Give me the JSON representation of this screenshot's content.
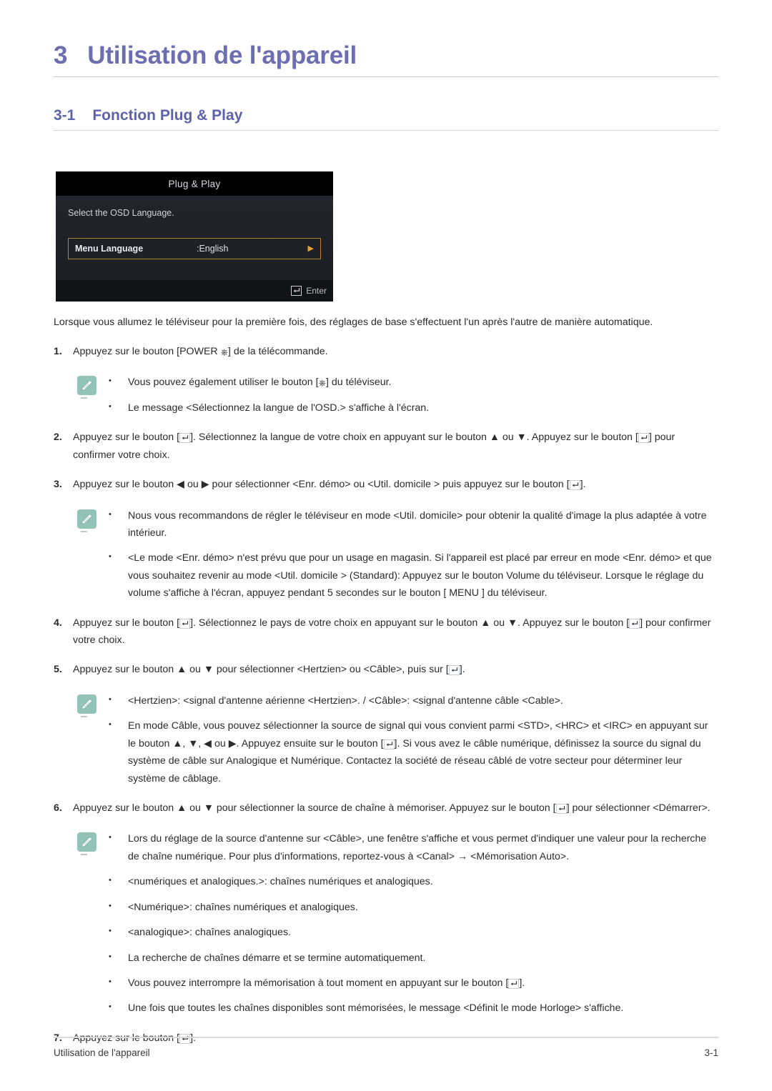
{
  "chapter": {
    "number": "3",
    "title": "Utilisation de l'appareil"
  },
  "section": {
    "number": "3-1",
    "title": "Fonction Plug & Play"
  },
  "osd": {
    "title": "Plug & Play",
    "prompt": "Select the OSD Language.",
    "row_label": "Menu Language",
    "row_value": ":English",
    "arrow_icon": "right-triangle-icon",
    "enter_label": "Enter",
    "enter_icon": "enter-key-icon",
    "border_color": "#b08432",
    "background_color": "#1c1f24"
  },
  "intro": "Lorsque vous allumez le téléviseur pour la première fois, des réglages de base s'effectuent l'un après l'autre de manière automatique.",
  "steps": [
    {
      "num": "1.",
      "text_before": "Appuyez sur le bouton [POWER ",
      "icon": "power-icon",
      "text_after": "] de la télécommande."
    },
    {
      "num": "2.",
      "text": "Appuyez sur le bouton [ENTER]. Sélectionnez la langue de votre choix en appuyant sur le bouton ▲ ou ▼. Appuyez sur le bouton [ENTER] pour confirmer votre choix."
    },
    {
      "num": "3.",
      "text": "Appuyez sur le bouton ◀ ou ▶ pour sélectionner <Enr. démo> ou <Util. domicile > puis appuyez sur le bouton [ENTER]."
    },
    {
      "num": "4.",
      "text": "Appuyez sur le bouton [ENTER]. Sélectionnez le pays de votre choix en appuyant sur le bouton ▲ ou ▼. Appuyez sur le bouton [ENTER] pour confirmer votre choix."
    },
    {
      "num": "5.",
      "text": "Appuyez sur le bouton ▲ ou ▼ pour sélectionner <Hertzien> ou <Câble>, puis sur [ENTER]."
    },
    {
      "num": "6.",
      "text": "Appuyez sur le bouton ▲ ou ▼ pour sélectionner la source de chaîne à mémoriser. Appuyez sur le bouton [ENTER] pour sélectionner <Démarrer>."
    },
    {
      "num": "7.",
      "text": "Appuyez sur le bouton [ENTER]."
    }
  ],
  "notes": {
    "note1": {
      "icon": "note-pencil-icon",
      "bullets": [
        "Vous pouvez également utiliser le bouton [⏻] du téléviseur.",
        "Le message <Sélectionnez la langue de l'OSD.> s'affiche à l'écran."
      ]
    },
    "note2": {
      "icon": "note-pencil-icon",
      "bullets": [
        "Nous vous recommandons de régler le téléviseur en mode <Util. domicile> pour obtenir la qualité d'image la plus adaptée à votre intérieur.",
        "<Le mode <Enr. démo> n'est prévu que pour un usage en magasin. Si l'appareil est placé par erreur en mode <Enr. démo> et que vous souhaitez revenir au mode <Util. domicile > (Standard): Appuyez sur le bouton Volume du téléviseur. Lorsque le réglage du volume s'affiche à l'écran, appuyez pendant 5 secondes sur le bouton [ MENU ] du téléviseur."
      ]
    },
    "note3": {
      "icon": "note-pencil-icon",
      "bullets": [
        "<Hertzien>: <signal d'antenne aérienne <Hertzien>. / <Câble>: <signal d'antenne câble <Cable>.",
        "En mode Câble, vous pouvez sélectionner la source de signal qui vous convient parmi <STD>, <HRC> et <IRC> en appuyant sur le bouton ▲, ▼, ◀ ou ▶. Appuyez ensuite sur le bouton [ENTER]. Si vous avez le câble numérique, définissez la source du signal du système de câble sur Analogique et Numérique. Contactez la société de réseau câblé de votre secteur pour déterminer leur système de câblage."
      ]
    },
    "note4": {
      "icon": "note-pencil-icon",
      "bullets": [
        "Lors du réglage de la source d'antenne sur <Câble>, une fenêtre s'affiche et vous permet d'indiquer une valeur pour la recherche de chaîne numérique. Pour plus d'informations, reportez-vous à <Canal> → <Mémorisation Auto>."
      ]
    },
    "extra_bullets": [
      "<numériques et analogiques.>: chaînes numériques et analogiques.",
      "<Numérique>: chaînes numériques et analogiques.",
      "<analogique>: chaînes analogiques.",
      "La recherche de chaînes démarre et se termine automatiquement.",
      "Vous pouvez interrompre la mémorisation à tout moment en appuyant sur le bouton [ENTER].",
      "Une fois que toutes les chaînes disponibles sont mémorisées, le message <Définit le mode Horloge> s'affiche."
    ]
  },
  "footer": {
    "left": "Utilisation de l'appareil",
    "right": "3-1"
  },
  "colors": {
    "chapter_title": "#6b6fb0",
    "section_title": "#5d63ab",
    "note_icon_bg": "#93c2b6"
  }
}
